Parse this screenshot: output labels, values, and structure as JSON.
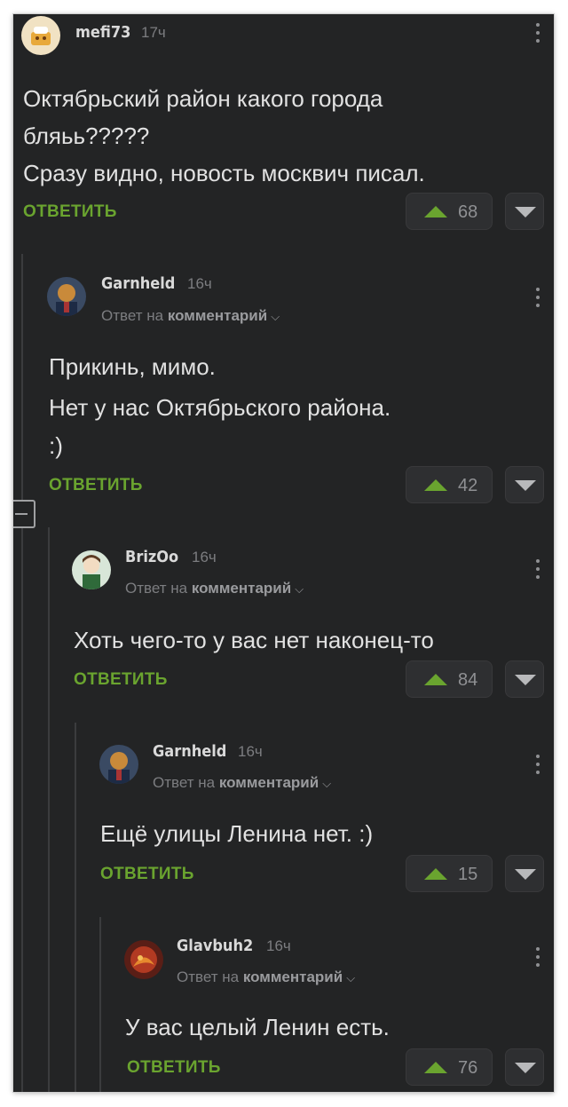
{
  "comments": [
    {
      "user": "mefi73",
      "time": "17ч",
      "reply_to_prefix": "",
      "reply_to_link": "",
      "lines": [
        "Октябрьский район какого города",
        "бляьь?????",
        "Сразу видно, новость москвич писал."
      ],
      "reply_label": "ОТВЕТИТЬ",
      "votes": "68"
    },
    {
      "user": "Garnheld",
      "time": "16ч",
      "reply_to_prefix": "Ответ на",
      "reply_to_link": "комментарий",
      "lines": [
        "Прикинь, мимо.",
        "Нет у нас Октябрьского района.",
        " :)"
      ],
      "reply_label": "ОТВЕТИТЬ",
      "votes": "42"
    },
    {
      "user": "BrizOo",
      "time": "16ч",
      "reply_to_prefix": "Ответ на",
      "reply_to_link": "комментарий",
      "lines": [
        "Хоть чего-то у вас нет наконец-то"
      ],
      "reply_label": "ОТВЕТИТЬ",
      "votes": "84"
    },
    {
      "user": "Garnheld",
      "time": "16ч",
      "reply_to_prefix": "Ответ на",
      "reply_to_link": "комментарий",
      "lines": [
        "Ещё улицы Ленина нет. :)"
      ],
      "reply_label": "ОТВЕТИТЬ",
      "votes": "15"
    },
    {
      "user": "Glavbuh2",
      "time": "16ч",
      "reply_to_prefix": "Ответ на",
      "reply_to_link": "комментарий",
      "lines": [
        "У вас целый Ленин есть."
      ],
      "reply_label": "ОТВЕТИТЬ",
      "votes": "76"
    }
  ],
  "icons": {
    "upvote": "upvote-triangle-icon",
    "downvote": "downvote-triangle-icon",
    "more": "kebab-menu-icon",
    "chevron": "chevron-down-icon",
    "collapse": "collapse-thread-icon"
  },
  "colors": {
    "background": "#232425",
    "accent": "#6aa42f",
    "text": "#e1e1e1",
    "muted": "#7c7d80"
  }
}
